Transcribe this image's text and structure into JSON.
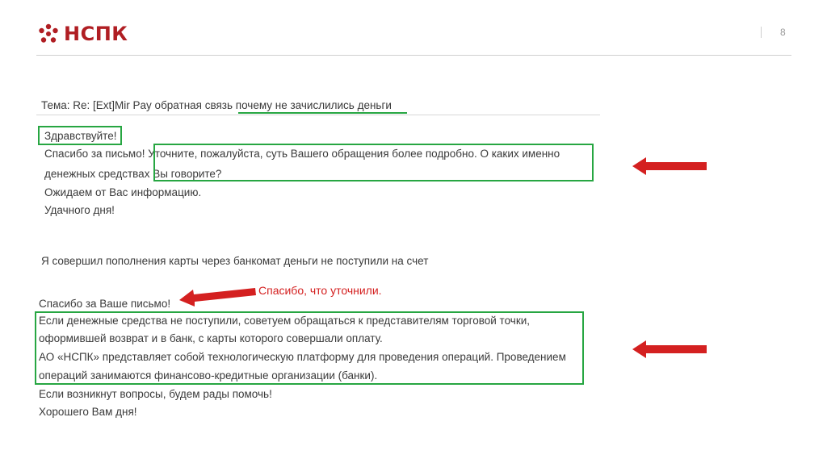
{
  "header": {
    "brand": "НСПК",
    "page_number": "8"
  },
  "email": {
    "subject_prefix": "Тема: Re: [Ext]Mir Pay обратная связь ",
    "subject_highlight": "почему не зачислились деньги",
    "greeting": "Здравствуйте!",
    "thanks_prefix": "Спасибо за письмо! ",
    "clarify_line1": "Уточните, пожалуйста, суть Вашего обращения более подробно. О каких именно",
    "money_prefix": "денежных средствах ",
    "clarify_line2": "Вы говорите?",
    "waiting": "Ожидаем от Вас информацию.",
    "farewell": "Удачного дня!",
    "customer_question": "Я совершил пополнения карты через банкомат деньги не поступили на счет",
    "reply_thanks": "Спасибо за Ваше письмо!",
    "reply_lines": [
      "Если денежные средства не поступили, советуем обращаться к представителям торговой точки,",
      "оформившей возврат и в банк, с карты которого совершали оплату.",
      "АО «НСПК» представляет собой технологическую платформу для проведения операций. Проведением",
      "операций занимаются финансово-кредитные организации (банки)."
    ],
    "closing_help": "Если возникнут вопросы, будем рады помочь!",
    "closing_wish": "Хорошего Вам дня!"
  },
  "annotation": {
    "text": "Спасибо, что уточнили."
  },
  "colors": {
    "brand": "#b01e23",
    "highlight": "#27a642",
    "arrow": "#d42020"
  }
}
